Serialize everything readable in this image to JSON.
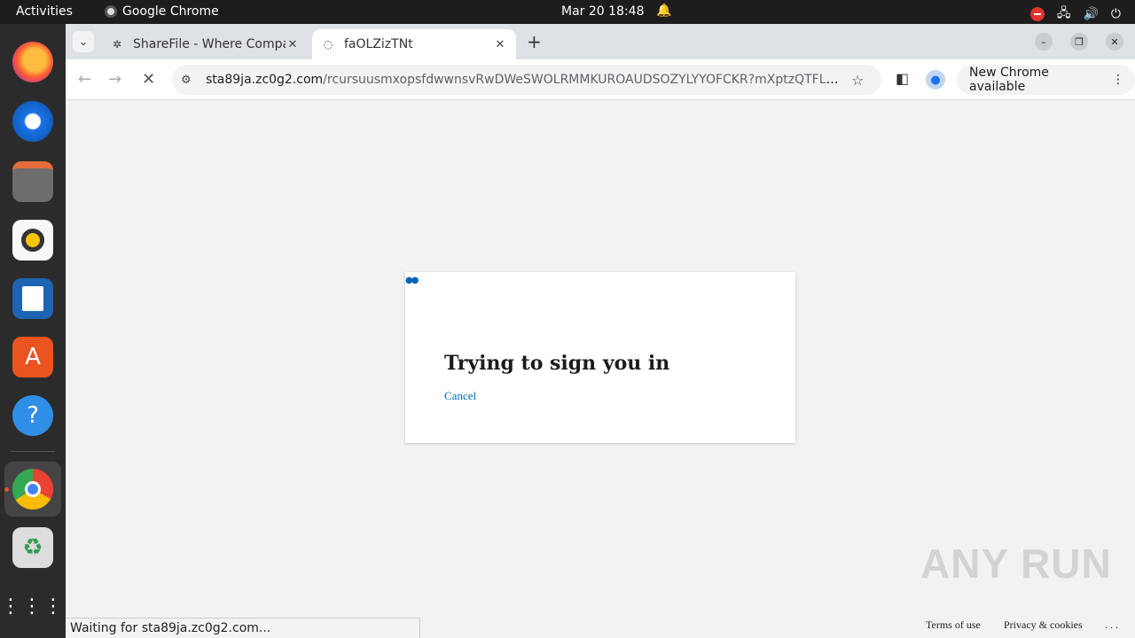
{
  "system": {
    "activities": "Activities",
    "app_name": "Google Chrome",
    "datetime": "Mar 20  18:48"
  },
  "tabs": [
    {
      "title": "ShareFile - Where Compa",
      "favicon": "sharefile-icon"
    },
    {
      "title": "faOLZizTNt",
      "favicon": "loading-icon"
    }
  ],
  "omnibox": {
    "host": "sta89ja.zc0g2.com",
    "path": "/rcursuusmxopsfdwwnsvRwDWeSWOLRMMKUROAUDSOZYLYYOFCKR?mXptzQTFLhvTuJjBJg..."
  },
  "update_button": "New Chrome available",
  "card": {
    "heading": "Trying to sign you in",
    "cancel": "Cancel"
  },
  "footer": {
    "terms": "Terms of use",
    "privacy": "Privacy & cookies",
    "more": ". . ."
  },
  "status": "Waiting for sta89ja.zc0g2.com...",
  "watermark": "ANY RUN"
}
